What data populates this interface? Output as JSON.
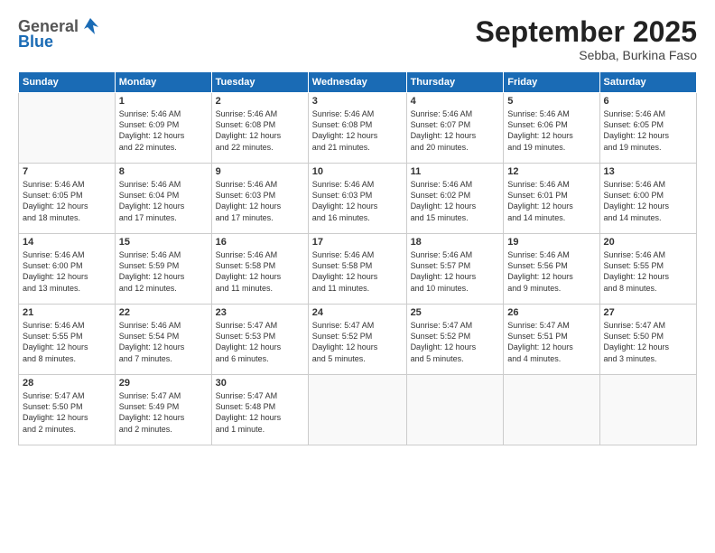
{
  "header": {
    "logo_general": "General",
    "logo_blue": "Blue",
    "month_title": "September 2025",
    "subtitle": "Sebba, Burkina Faso"
  },
  "days_of_week": [
    "Sunday",
    "Monday",
    "Tuesday",
    "Wednesday",
    "Thursday",
    "Friday",
    "Saturday"
  ],
  "weeks": [
    [
      {
        "day": "",
        "info": ""
      },
      {
        "day": "1",
        "info": "Sunrise: 5:46 AM\nSunset: 6:09 PM\nDaylight: 12 hours\nand 22 minutes."
      },
      {
        "day": "2",
        "info": "Sunrise: 5:46 AM\nSunset: 6:08 PM\nDaylight: 12 hours\nand 22 minutes."
      },
      {
        "day": "3",
        "info": "Sunrise: 5:46 AM\nSunset: 6:08 PM\nDaylight: 12 hours\nand 21 minutes."
      },
      {
        "day": "4",
        "info": "Sunrise: 5:46 AM\nSunset: 6:07 PM\nDaylight: 12 hours\nand 20 minutes."
      },
      {
        "day": "5",
        "info": "Sunrise: 5:46 AM\nSunset: 6:06 PM\nDaylight: 12 hours\nand 19 minutes."
      },
      {
        "day": "6",
        "info": "Sunrise: 5:46 AM\nSunset: 6:05 PM\nDaylight: 12 hours\nand 19 minutes."
      }
    ],
    [
      {
        "day": "7",
        "info": "Sunrise: 5:46 AM\nSunset: 6:05 PM\nDaylight: 12 hours\nand 18 minutes."
      },
      {
        "day": "8",
        "info": "Sunrise: 5:46 AM\nSunset: 6:04 PM\nDaylight: 12 hours\nand 17 minutes."
      },
      {
        "day": "9",
        "info": "Sunrise: 5:46 AM\nSunset: 6:03 PM\nDaylight: 12 hours\nand 17 minutes."
      },
      {
        "day": "10",
        "info": "Sunrise: 5:46 AM\nSunset: 6:03 PM\nDaylight: 12 hours\nand 16 minutes."
      },
      {
        "day": "11",
        "info": "Sunrise: 5:46 AM\nSunset: 6:02 PM\nDaylight: 12 hours\nand 15 minutes."
      },
      {
        "day": "12",
        "info": "Sunrise: 5:46 AM\nSunset: 6:01 PM\nDaylight: 12 hours\nand 14 minutes."
      },
      {
        "day": "13",
        "info": "Sunrise: 5:46 AM\nSunset: 6:00 PM\nDaylight: 12 hours\nand 14 minutes."
      }
    ],
    [
      {
        "day": "14",
        "info": "Sunrise: 5:46 AM\nSunset: 6:00 PM\nDaylight: 12 hours\nand 13 minutes."
      },
      {
        "day": "15",
        "info": "Sunrise: 5:46 AM\nSunset: 5:59 PM\nDaylight: 12 hours\nand 12 minutes."
      },
      {
        "day": "16",
        "info": "Sunrise: 5:46 AM\nSunset: 5:58 PM\nDaylight: 12 hours\nand 11 minutes."
      },
      {
        "day": "17",
        "info": "Sunrise: 5:46 AM\nSunset: 5:58 PM\nDaylight: 12 hours\nand 11 minutes."
      },
      {
        "day": "18",
        "info": "Sunrise: 5:46 AM\nSunset: 5:57 PM\nDaylight: 12 hours\nand 10 minutes."
      },
      {
        "day": "19",
        "info": "Sunrise: 5:46 AM\nSunset: 5:56 PM\nDaylight: 12 hours\nand 9 minutes."
      },
      {
        "day": "20",
        "info": "Sunrise: 5:46 AM\nSunset: 5:55 PM\nDaylight: 12 hours\nand 8 minutes."
      }
    ],
    [
      {
        "day": "21",
        "info": "Sunrise: 5:46 AM\nSunset: 5:55 PM\nDaylight: 12 hours\nand 8 minutes."
      },
      {
        "day": "22",
        "info": "Sunrise: 5:46 AM\nSunset: 5:54 PM\nDaylight: 12 hours\nand 7 minutes."
      },
      {
        "day": "23",
        "info": "Sunrise: 5:47 AM\nSunset: 5:53 PM\nDaylight: 12 hours\nand 6 minutes."
      },
      {
        "day": "24",
        "info": "Sunrise: 5:47 AM\nSunset: 5:52 PM\nDaylight: 12 hours\nand 5 minutes."
      },
      {
        "day": "25",
        "info": "Sunrise: 5:47 AM\nSunset: 5:52 PM\nDaylight: 12 hours\nand 5 minutes."
      },
      {
        "day": "26",
        "info": "Sunrise: 5:47 AM\nSunset: 5:51 PM\nDaylight: 12 hours\nand 4 minutes."
      },
      {
        "day": "27",
        "info": "Sunrise: 5:47 AM\nSunset: 5:50 PM\nDaylight: 12 hours\nand 3 minutes."
      }
    ],
    [
      {
        "day": "28",
        "info": "Sunrise: 5:47 AM\nSunset: 5:50 PM\nDaylight: 12 hours\nand 2 minutes."
      },
      {
        "day": "29",
        "info": "Sunrise: 5:47 AM\nSunset: 5:49 PM\nDaylight: 12 hours\nand 2 minutes."
      },
      {
        "day": "30",
        "info": "Sunrise: 5:47 AM\nSunset: 5:48 PM\nDaylight: 12 hours\nand 1 minute."
      },
      {
        "day": "",
        "info": ""
      },
      {
        "day": "",
        "info": ""
      },
      {
        "day": "",
        "info": ""
      },
      {
        "day": "",
        "info": ""
      }
    ]
  ]
}
